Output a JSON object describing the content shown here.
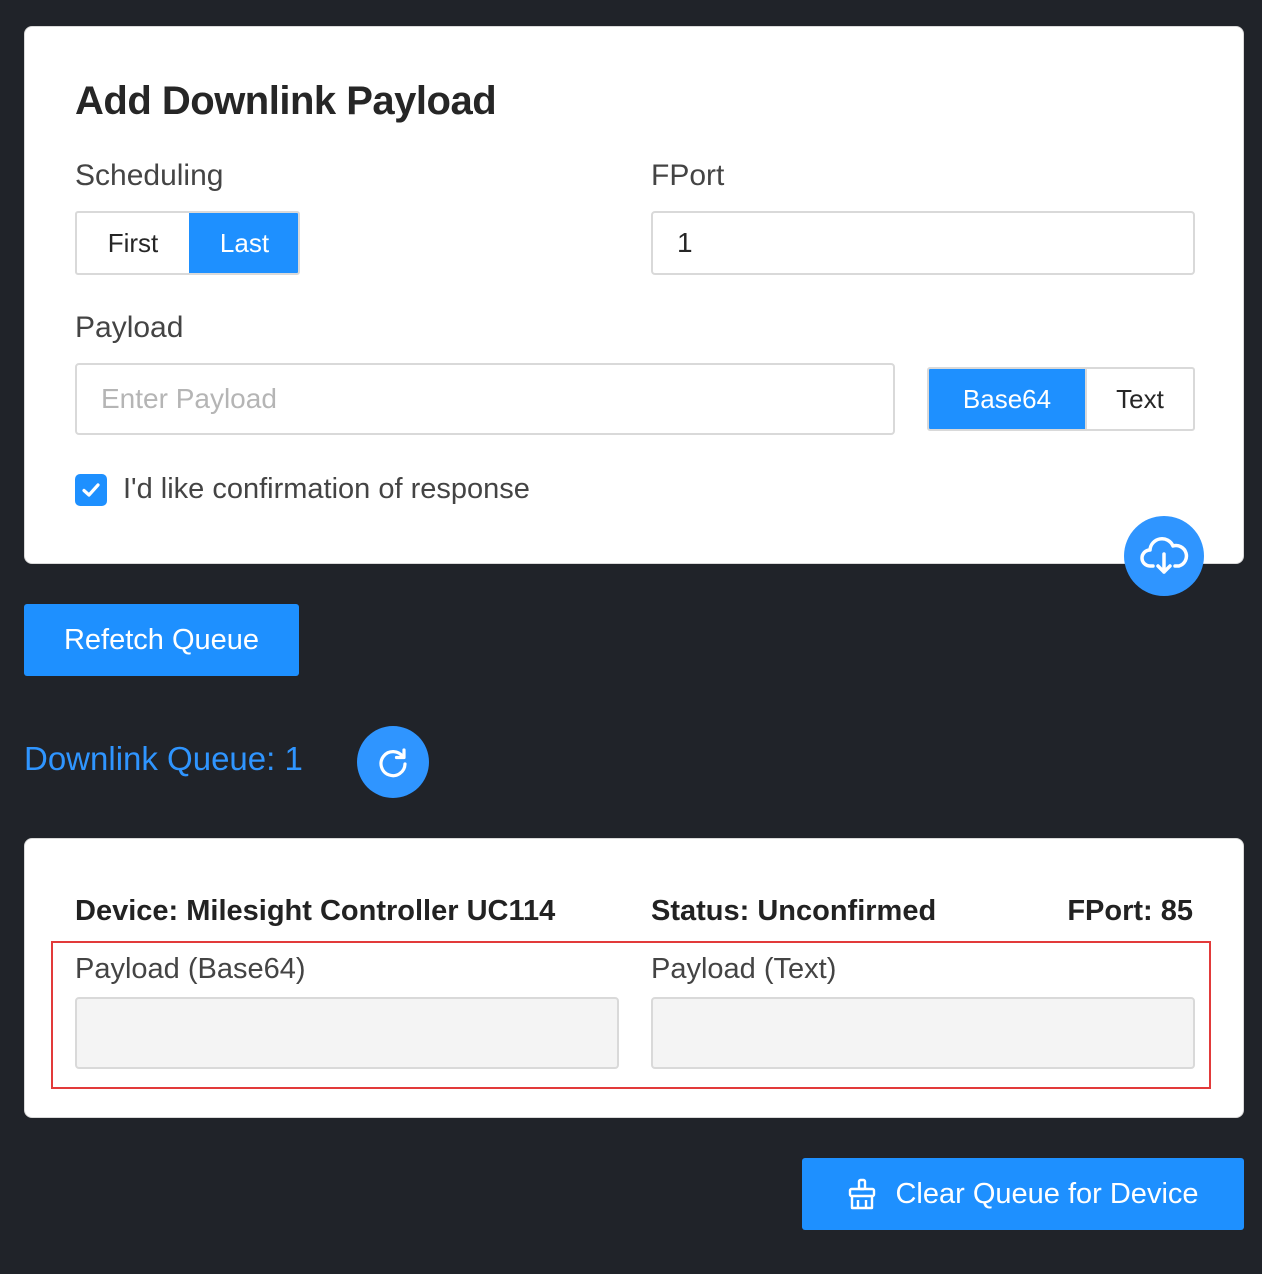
{
  "add_form": {
    "title": "Add Downlink Payload",
    "scheduling_label": "Scheduling",
    "scheduling_options": [
      "First",
      "Last"
    ],
    "scheduling_selected": "Last",
    "fport_label": "FPort",
    "fport_value": "1",
    "payload_label": "Payload",
    "payload_placeholder": "Enter Payload",
    "payload_value": "",
    "encoding_options": [
      "Base64",
      "Text"
    ],
    "encoding_selected": "Base64",
    "confirm_label": "I'd like confirmation of response",
    "confirm_checked": true,
    "submit_icon": "cloud-download-icon"
  },
  "refetch_button_label": "Refetch Queue",
  "queue": {
    "title": "Downlink Queue: 1",
    "refresh_icon": "refresh-icon",
    "item": {
      "device": "Device: Milesight Controller UC114",
      "status": "Status: Unconfirmed",
      "fport": "FPort: 85",
      "payload_base64_label": "Payload (Base64)",
      "payload_base64_value": "",
      "payload_text_label": "Payload (Text)",
      "payload_text_value": ""
    }
  },
  "clear_button": {
    "label": "Clear Queue for Device",
    "icon": "broom-icon"
  },
  "colors": {
    "background": "#202329",
    "accent": "#1e90ff",
    "highlight": "#e23a3a"
  }
}
